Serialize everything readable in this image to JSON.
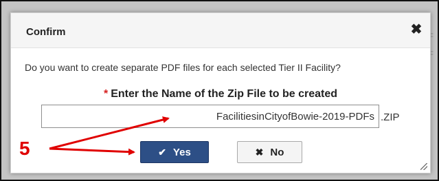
{
  "dialog": {
    "title": "Confirm",
    "close_icon": "close-icon",
    "close_glyph": "✖",
    "question": "Do you want to create separate PDF files for each selected Tier II Facility?",
    "zip_label": "Enter the Name of the Zip File to be created",
    "required_mark": "*",
    "zip_value": "FacilitiesinCityofBowie-2019-PDFs",
    "zip_extension": ".ZIP",
    "yes_button": {
      "label": "Yes",
      "icon": "check-icon",
      "glyph": "✔"
    },
    "no_button": {
      "label": "No",
      "icon": "x-icon",
      "glyph": "✖"
    }
  },
  "annotation": {
    "number": "5",
    "color": "#e00000"
  },
  "colors": {
    "primary_button": "#2d4f86",
    "required": "#d62020"
  }
}
